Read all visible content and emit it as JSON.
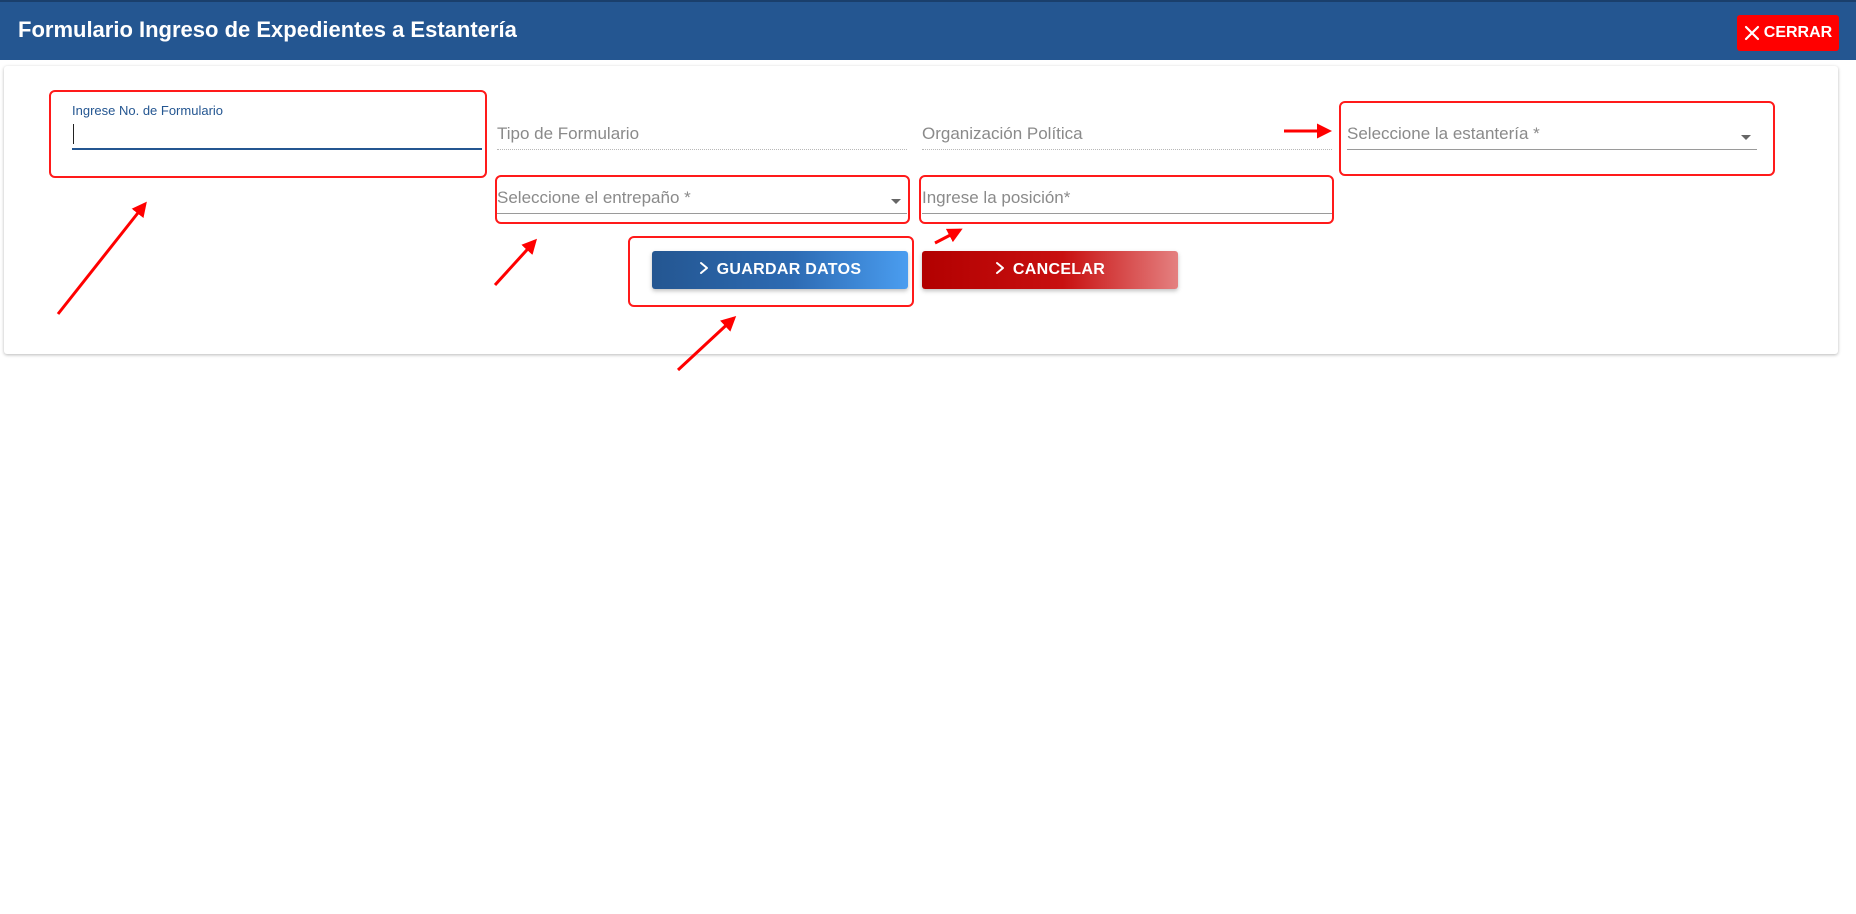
{
  "header": {
    "title": "Formulario Ingreso de Expedientes a Estantería",
    "close_label": "CERRAR",
    "background_color": "#245691",
    "close_color": "#ff0000"
  },
  "form": {
    "form_number": {
      "label": "Ingrese No. de Formulario",
      "value": ""
    },
    "form_type": {
      "placeholder": "Tipo de Formulario"
    },
    "political_org": {
      "placeholder": "Organización Política"
    },
    "shelf_select": {
      "placeholder": "Seleccione la estantería *"
    },
    "shelf_level_select": {
      "placeholder": "Seleccione el entrepaño *"
    },
    "position": {
      "placeholder": "Ingrese la posición*"
    }
  },
  "actions": {
    "save_label": "GUARDAR DATOS",
    "cancel_label": "CANCELAR",
    "save_icon": "chevron-right-icon",
    "cancel_icon": "chevron-right-icon"
  },
  "annotation_color": "#ff1a1a"
}
